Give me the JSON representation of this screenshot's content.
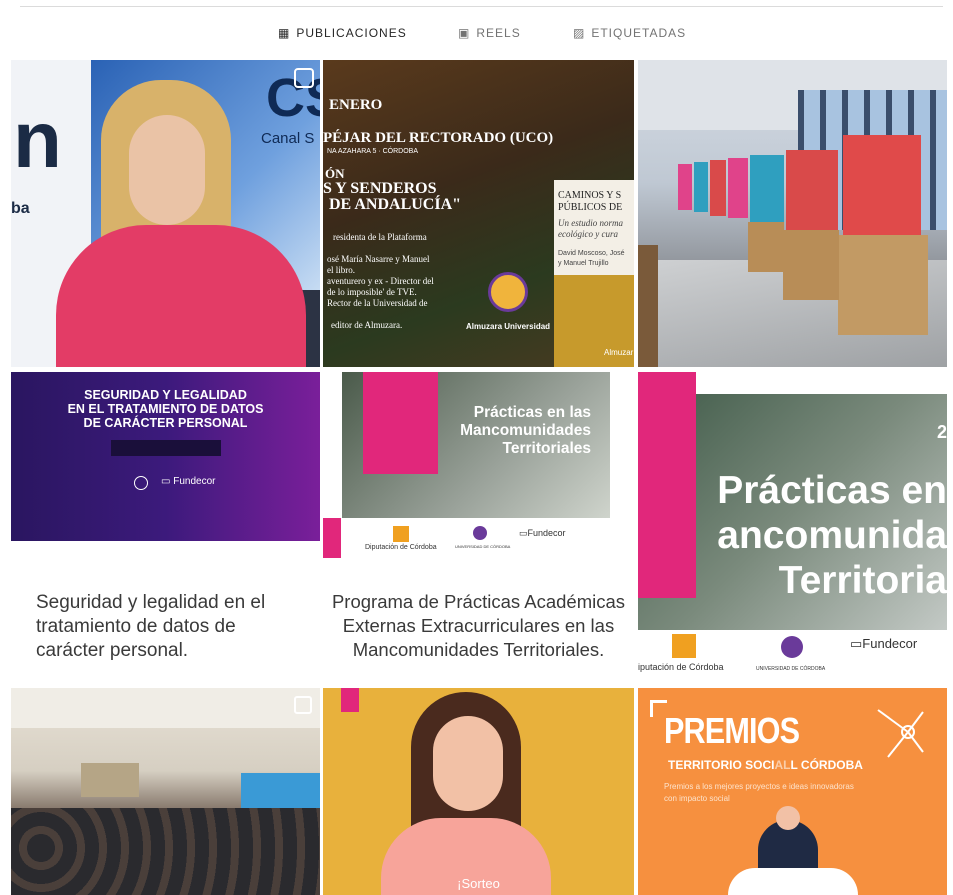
{
  "tabs": [
    {
      "label": "PUBLICACIONES",
      "icon": "grid-icon",
      "active": true
    },
    {
      "label": "REELS",
      "icon": "reels-icon",
      "active": false
    },
    {
      "label": "ETIQUETADAS",
      "icon": "tagged-icon",
      "active": false
    }
  ],
  "posts": {
    "p1": {
      "logo_text": "CS",
      "logo_sub": "Canal S"
    },
    "p2": {
      "l1": "ENERO",
      "l2": "PÉJAR DEL RECTORADO (UCO)",
      "l3": "NA AZAHARA 5 · CÓRDOBA",
      "l4": "ÓN",
      "l5": "S Y SENDEROS",
      "l6": "DE ANDALUCÍA\"",
      "l7": "residenta de la Plataforma",
      "l8": "osé María Nasarre y Manuel",
      "l9": "el libro.",
      "l10": "aventurero y ex - Director del",
      "l11": "de lo imposible' de TVE.",
      "l12": "Rector de la Universidad de",
      "l13": "editor de Almuzara.",
      "book_title": "CAMINOS Y S",
      "book_sub": "PÚBLICOS DE",
      "book_desc": "Un estudio norma",
      "book_desc2": "ecológico y cura",
      "book_auth": "David Moscoso, José",
      "book_auth2": "y Manuel Trujillo",
      "publisher": "Almuzara",
      "publisher2": "Universidad",
      "book_pub": "Almuzar"
    },
    "p4": {
      "title1": "SEGURIDAD Y LEGALIDAD",
      "title2": "EN EL TRATAMIENTO DE DATOS",
      "title3": "DE CARÁCTER PERSONAL",
      "caption": "Seguridad y legalidad en el tratamiento de datos de carácter personal.",
      "logo": "Fundecor"
    },
    "p5": {
      "t1": "Prácticas en las",
      "t2": "Mancomunidades",
      "t3": "Territoriales",
      "logo1": "Diputación de Córdoba",
      "logo2": "UNIVERSIDAD DE CÓRDOBA",
      "logo3": "Fundecor",
      "caption": "Programa de Prácticas Académicas Externas Extracurriculares en las Mancomunidades Territoriales."
    },
    "p6": {
      "t1": "Prácticas en",
      "t2": "ancomunida",
      "t3": "Territoria",
      "year": "2",
      "logo1": "iputación de Córdoba",
      "logo2": "UNIVERSIDAD DE CÓRDOBA",
      "logo3": "Fundecor"
    },
    "p8": {
      "text": "¡Sorteo"
    },
    "p9": {
      "t1": "PREMIOS",
      "t2": "TERRITORIO SOCI",
      "t3": "L CÓRDOBA",
      "t2b": "AL",
      "desc1": "Premios a los mejores proyectos e ideas innovadoras",
      "desc2": "con impacto social"
    }
  },
  "colors": {
    "magenta": "#e1277b",
    "purple": "#3c1a7c",
    "orange": "#f6903f",
    "mustard": "#e8b13c"
  }
}
